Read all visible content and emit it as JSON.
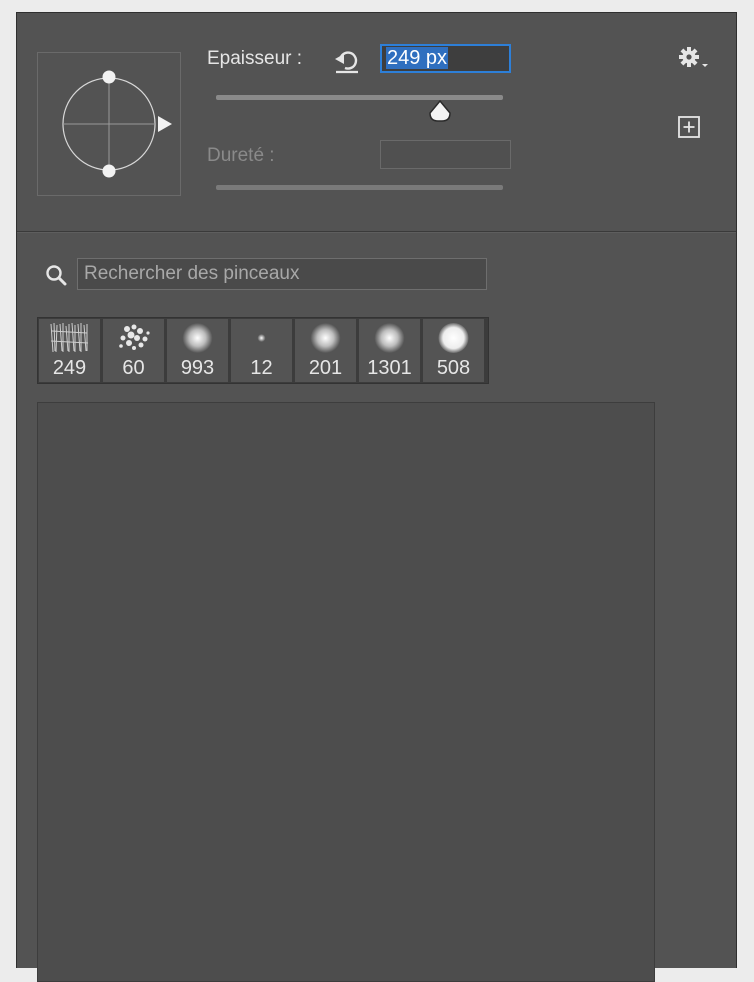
{
  "size": {
    "label": "Epaisseur :",
    "value": "249 px",
    "slider_fraction": 0.78
  },
  "hardness": {
    "label": "Dureté :",
    "value": ""
  },
  "search": {
    "placeholder": "Rechercher des pinceaux"
  },
  "brushes": [
    {
      "size": "249",
      "kind": "texture-strokes"
    },
    {
      "size": "60",
      "kind": "scatter-leaf"
    },
    {
      "size": "993",
      "kind": "soft-round"
    },
    {
      "size": "12",
      "kind": "small-dot"
    },
    {
      "size": "201",
      "kind": "soft-round"
    },
    {
      "size": "1301",
      "kind": "soft-round"
    },
    {
      "size": "508",
      "kind": "hard-soft-round"
    }
  ],
  "icons": {
    "reset": "reset-icon",
    "gear": "gear-icon",
    "new_preset": "new-preset-icon",
    "search": "search-icon"
  },
  "colors": {
    "panel": "#535353",
    "accent": "#2d7fd8"
  }
}
